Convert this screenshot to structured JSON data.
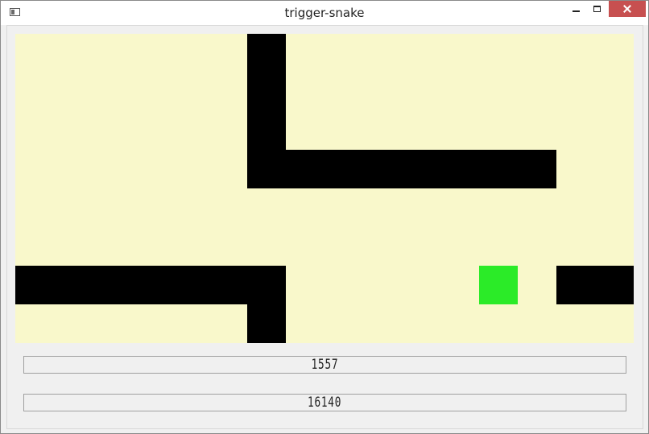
{
  "window": {
    "title": "trigger-snake"
  },
  "game": {
    "board": {
      "cols": 16,
      "rows": 8,
      "background": "#f9f8cb"
    },
    "snake": {
      "color": "#000000",
      "cells": [
        [
          6,
          0
        ],
        [
          6,
          1
        ],
        [
          6,
          2
        ],
        [
          6,
          3
        ],
        [
          7,
          3
        ],
        [
          8,
          3
        ],
        [
          9,
          3
        ],
        [
          10,
          3
        ],
        [
          11,
          3
        ],
        [
          12,
          3
        ],
        [
          13,
          3
        ],
        [
          0,
          6
        ],
        [
          1,
          6
        ],
        [
          2,
          6
        ],
        [
          3,
          6
        ],
        [
          4,
          6
        ],
        [
          5,
          6
        ],
        [
          6,
          6
        ],
        [
          6,
          7
        ],
        [
          14,
          6
        ],
        [
          15,
          6
        ]
      ]
    },
    "food": {
      "color": "#2beb28",
      "cell": [
        12,
        6
      ]
    }
  },
  "counters": {
    "first": "1557",
    "second": "16140"
  }
}
